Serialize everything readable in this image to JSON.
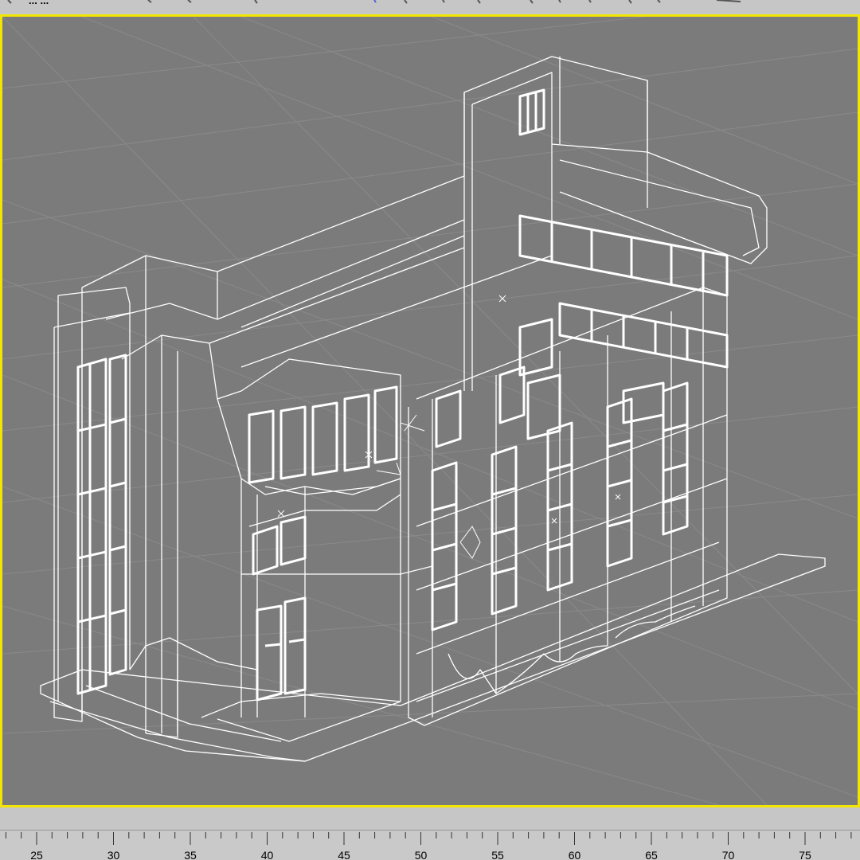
{
  "window": {
    "title_fragment": "... ..."
  },
  "viewport": {
    "name": "Perspective wireframe viewport",
    "background_color": "#7b7b7b",
    "border_color": "#f2e600",
    "wire_color": "#ffffff",
    "grid_color": "#8a8a8a",
    "subject": "building wireframe model"
  },
  "timeline": {
    "labels": [
      "25",
      "30",
      "35",
      "40",
      "45",
      "50",
      "55",
      "60",
      "65",
      "70",
      "75"
    ],
    "values": [
      25,
      30,
      35,
      40,
      45,
      50,
      55,
      60,
      65,
      70,
      75
    ]
  }
}
